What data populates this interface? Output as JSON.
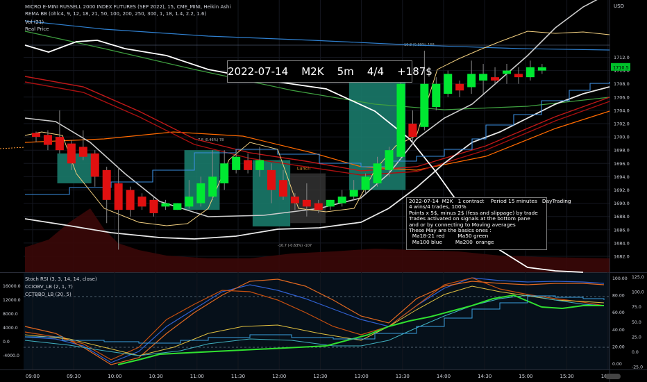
{
  "header": {
    "symbol_line": "MICRO E-MINI RUSSELL 2000 INDEX FUTURES (SEP 2022), 15, CME_MINI, Heikin Ashi",
    "rema_line": "REMA BB (ohlc4, 9, 12, 18, 21, 50, 100, 200, 250, 300, 1, 18, 1.4, 2.2, 1.6)",
    "vol_line": "Vol (21)",
    "real_price_line": "Real Price",
    "currency": "USD"
  },
  "trade_banner": "2022-07-14    M2K    5m    4/4    +187$",
  "notes": [
    "2022-07-14  M2K   1 contract    Period 15 minutes   DayTrading",
    "4 wins/4 trades, 100%",
    "Points x 5$, minus 2$ (fess and slippage) by trade",
    "Trades activated on signals at the bottom pane",
    "and or by connecting to Moving averages",
    "These May are the basics ones :",
    "  Ma18-21 red        Ma50 green",
    "  Ma100 blue        Ma200  orange"
  ],
  "annotations": {
    "lunch": "Lunch",
    "top_line_label": "16.8 (0.99%) 168",
    "mid_line_label": "7.8 (0.46%) 78",
    "low_line_label": "-10.7 (-0.63%) -107"
  },
  "indicator_headers": [
    "Stoch RSI (3, 3, 14, 14, close)",
    "CCIOBV_LB (2, 1, 7)",
    "CCTBBO_LB (20, 5)"
  ],
  "colors": {
    "bull": "#00e832",
    "bear": "#e01010",
    "trade_box": "#1a7a6a",
    "lunch_box": "#3a3a3a"
  },
  "chart_data": {
    "type": "candlestick",
    "price_axis": {
      "ticks": [
        1682.0,
        1684.0,
        1686.0,
        1688.0,
        1690.0,
        1692.0,
        1694.0,
        1696.0,
        1698.0,
        1700.0,
        1702.0,
        1704.0,
        1706.0,
        1708.0,
        1710.0,
        1712.0
      ],
      "last_price": "1710.5"
    },
    "time_axis": [
      "09:00",
      "09:30",
      "10:00",
      "10:30",
      "11:00",
      "11:30",
      "12:00",
      "12:30",
      "13:00",
      "13:30",
      "14:00",
      "14:30",
      "15:00",
      "15:30",
      "16:00"
    ],
    "left_axis_ticks": [
      "16000.0",
      "12000.0",
      "8000.0",
      "4000.0",
      "0.0",
      "-4000.0"
    ],
    "right_axis_ticks_a": [
      "100.00",
      "80.00",
      "60.00",
      "40.00",
      "20.00",
      "0.00"
    ],
    "right_axis_ticks_b": [
      "125.0",
      "100.0",
      "75.0",
      "50.0",
      "25.0",
      "0.0",
      "-25.0"
    ],
    "candles": [
      {
        "o": 1700.6,
        "c": 1700.0,
        "h": 1700.8,
        "l": 1699.2
      },
      {
        "o": 1700.3,
        "c": 1698.8,
        "h": 1701.0,
        "l": 1698.0
      },
      {
        "o": 1700.0,
        "c": 1698.0,
        "h": 1704.0,
        "l": 1697.5
      },
      {
        "o": 1699.0,
        "c": 1696.0,
        "h": 1699.5,
        "l": 1695.0
      },
      {
        "o": 1698.5,
        "c": 1697.0,
        "h": 1701.0,
        "l": 1696.5
      },
      {
        "o": 1697.5,
        "c": 1694.0,
        "h": 1698.0,
        "l": 1692.5
      },
      {
        "o": 1695.0,
        "c": 1690.5,
        "h": 1695.5,
        "l": 1687.0
      },
      {
        "o": 1693.0,
        "c": 1689.0,
        "h": 1695.5,
        "l": 1683.0
      },
      {
        "o": 1692.0,
        "c": 1689.0,
        "h": 1692.5,
        "l": 1688.0
      },
      {
        "o": 1691.0,
        "c": 1689.5,
        "h": 1691.5,
        "l": 1689.0
      },
      {
        "o": 1690.5,
        "c": 1688.5,
        "h": 1691.0,
        "l": 1688.0
      },
      {
        "o": 1689.5,
        "c": 1690.0,
        "h": 1690.5,
        "l": 1689.0
      },
      {
        "o": 1689.0,
        "c": 1690.0,
        "h": 1690.0,
        "l": 1689.0
      },
      {
        "o": 1689.5,
        "c": 1691.0,
        "h": 1693.5,
        "l": 1689.2
      },
      {
        "o": 1690.0,
        "c": 1693.0,
        "h": 1694.0,
        "l": 1689.5
      },
      {
        "o": 1691.0,
        "c": 1694.0,
        "h": 1698.0,
        "l": 1690.5
      },
      {
        "o": 1693.0,
        "c": 1696.0,
        "h": 1698.0,
        "l": 1692.0
      },
      {
        "o": 1695.0,
        "c": 1697.0,
        "h": 1698.0,
        "l": 1694.5
      },
      {
        "o": 1696.5,
        "c": 1695.0,
        "h": 1697.5,
        "l": 1694.5
      },
      {
        "o": 1695.0,
        "c": 1696.5,
        "h": 1698.5,
        "l": 1694.0
      },
      {
        "o": 1695.0,
        "c": 1692.0,
        "h": 1696.0,
        "l": 1690.0
      },
      {
        "o": 1693.5,
        "c": 1691.0,
        "h": 1695.0,
        "l": 1690.5
      },
      {
        "o": 1691.0,
        "c": 1690.0,
        "h": 1691.5,
        "l": 1689.0
      },
      {
        "o": 1690.5,
        "c": 1689.5,
        "h": 1693.0,
        "l": 1688.0
      },
      {
        "o": 1690.0,
        "c": 1689.0,
        "h": 1690.5,
        "l": 1688.5
      },
      {
        "o": 1689.5,
        "c": 1690.5,
        "h": 1690.5,
        "l": 1689.0
      },
      {
        "o": 1690.0,
        "c": 1691.0,
        "h": 1692.0,
        "l": 1689.5
      },
      {
        "o": 1691.0,
        "c": 1692.0,
        "h": 1693.5,
        "l": 1690.5
      },
      {
        "o": 1692.0,
        "c": 1694.0,
        "h": 1694.5,
        "l": 1691.5
      },
      {
        "o": 1693.0,
        "c": 1696.0,
        "h": 1697.0,
        "l": 1692.5
      },
      {
        "o": 1695.0,
        "c": 1698.0,
        "h": 1698.5,
        "l": 1694.0
      },
      {
        "o": 1697.0,
        "c": 1708.0,
        "h": 1708.5,
        "l": 1696.5
      },
      {
        "o": 1702.0,
        "c": 1700.0,
        "h": 1704.0,
        "l": 1699.0
      },
      {
        "o": 1701.5,
        "c": 1708.0,
        "h": 1713.0,
        "l": 1701.0
      },
      {
        "o": 1704.5,
        "c": 1708.0,
        "h": 1709.0,
        "l": 1704.0
      },
      {
        "o": 1706.5,
        "c": 1709.5,
        "h": 1710.0,
        "l": 1706.0
      },
      {
        "o": 1708.0,
        "c": 1707.0,
        "h": 1708.5,
        "l": 1706.0
      },
      {
        "o": 1707.5,
        "c": 1709.5,
        "h": 1711.5,
        "l": 1706.5
      },
      {
        "o": 1708.5,
        "c": 1709.5,
        "h": 1711.0,
        "l": 1706.5
      },
      {
        "o": 1709.0,
        "c": 1708.5,
        "h": 1710.5,
        "l": 1708.0
      },
      {
        "o": 1709.5,
        "c": 1710.0,
        "h": 1711.0,
        "l": 1708.0
      },
      {
        "o": 1709.5,
        "c": 1709.0,
        "h": 1710.5,
        "l": 1708.0
      },
      {
        "o": 1709.0,
        "c": 1710.5,
        "h": 1711.5,
        "l": 1708.5
      },
      {
        "o": 1710.0,
        "c": 1710.5,
        "h": 1711.0,
        "l": 1709.5
      }
    ],
    "trade_zones": [
      {
        "x0": 1.8,
        "x1": 4.7,
        "y0": 1693.0,
        "y1": 1697.5,
        "kind": "trade"
      },
      {
        "x0": 12.6,
        "x1": 15.6,
        "y0": 1689.0,
        "y1": 1698.0,
        "kind": "trade"
      },
      {
        "x0": 18.4,
        "x1": 21.6,
        "y0": 1686.5,
        "y1": 1696.5,
        "kind": "trade"
      },
      {
        "x0": 21.6,
        "x1": 24.6,
        "y0": 1687.0,
        "y1": 1694.5,
        "kind": "lunch"
      },
      {
        "x0": 26.6,
        "x1": 31.4,
        "y0": 1692.0,
        "y1": 1709.0,
        "kind": "trade"
      }
    ]
  }
}
